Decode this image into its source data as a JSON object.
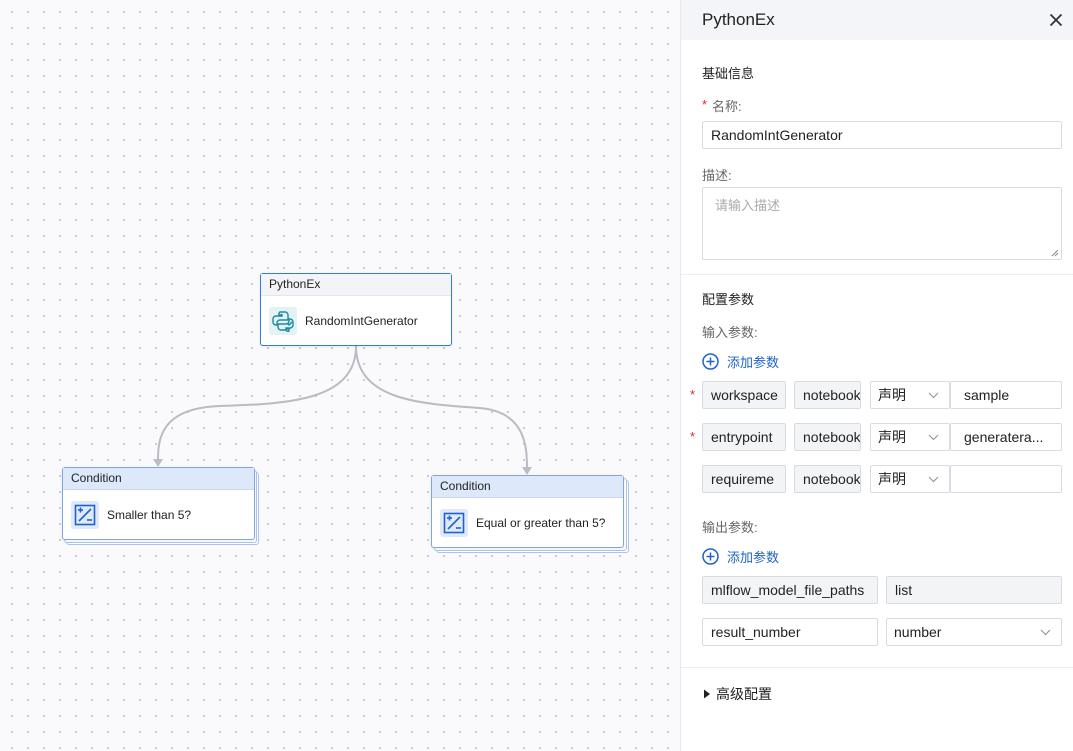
{
  "canvas": {
    "python_node": {
      "header": "PythonEx",
      "label": "RandomIntGenerator"
    },
    "condition_left": {
      "header": "Condition",
      "label": "Smaller than 5?"
    },
    "condition_right": {
      "header": "Condition",
      "label": "Equal or greater than 5?"
    }
  },
  "panel": {
    "title": "PythonEx",
    "basic": {
      "section_title": "基础信息",
      "name_label": "名称:",
      "name_value": "RandomIntGenerator",
      "desc_label": "描述:",
      "desc_placeholder": "请输入描述"
    },
    "config": {
      "section_title": "配置参数",
      "input_label": "输入参数:",
      "add_input_label": "添加参数",
      "inputs": [
        {
          "required": true,
          "name": "workspace",
          "type": "notebook",
          "mode": "声明",
          "value": "sample"
        },
        {
          "required": true,
          "name": "entrypoint",
          "type": "notebook",
          "mode": "声明",
          "value": "generatera..."
        },
        {
          "required": false,
          "name": "requireme",
          "type": "notebook",
          "mode": "声明",
          "value": ""
        }
      ],
      "output_label": "输出参数:",
      "add_output_label": "添加参数",
      "outputs": [
        {
          "name": "mlflow_model_file_paths",
          "type": "list",
          "editable": false
        },
        {
          "name": "result_number",
          "type": "number",
          "editable": true
        }
      ]
    },
    "advanced_label": "高级配置"
  },
  "colors": {
    "accent": "#1f63c6",
    "node_border": "#2f7de1",
    "required": "#e0262a",
    "edge": "#b9bcc4"
  }
}
